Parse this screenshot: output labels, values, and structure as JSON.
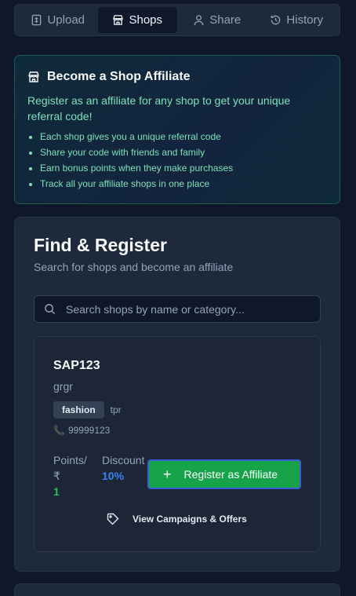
{
  "tabs": [
    {
      "label": "Upload",
      "icon": "upload-doc-icon",
      "active": false
    },
    {
      "label": "Shops",
      "icon": "store-icon",
      "active": true
    },
    {
      "label": "Share",
      "icon": "user-icon",
      "active": false
    },
    {
      "label": "History",
      "icon": "history-icon",
      "active": false
    }
  ],
  "affiliate": {
    "title": "Become a Shop Affiliate",
    "description": "Register as an affiliate for any shop to get your unique referral code!",
    "bullets": [
      "Each shop gives you a unique referral code",
      "Share your code with friends and family",
      "Earn bonus points when they make purchases",
      "Track all your affiliate shops in one place"
    ]
  },
  "find": {
    "title": "Find & Register",
    "subtitle": "Search for shops and become an affiliate",
    "search_placeholder": "Search shops by name or category..."
  },
  "shop": {
    "name": "SAP123",
    "description": "grgr",
    "category": "fashion",
    "location": "tpr",
    "phone": "99999123",
    "points_label_1": "Points/",
    "points_label_2": "₹",
    "points_value": "1",
    "discount_label": "Discount",
    "discount_value": "10%",
    "register_label": "Register as Affiliate",
    "campaigns_label": "View Campaigns & Offers"
  },
  "colors": {
    "background": "#0f172a",
    "accent_green": "#16a34a",
    "points_green": "#22c55e",
    "discount_blue": "#3b82f6",
    "affiliate_text": "#7ee2b8"
  }
}
